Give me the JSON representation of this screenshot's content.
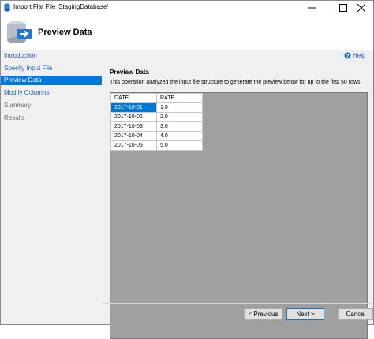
{
  "window": {
    "title": "Import Flat File 'StagingDatabase'",
    "icons": {
      "app": "database-icon",
      "minimize": "minimize-icon",
      "maximize": "maximize-icon",
      "close": "close-icon"
    }
  },
  "header": {
    "title": "Preview Data",
    "icon": "database-import-icon"
  },
  "nav": {
    "items": [
      {
        "label": "Introduction",
        "state": "link"
      },
      {
        "label": "Specify Input File",
        "state": "link"
      },
      {
        "label": "Preview Data",
        "state": "active"
      },
      {
        "label": "Modify Columns",
        "state": "link"
      },
      {
        "label": "Summary",
        "state": "disabled"
      },
      {
        "label": "Results",
        "state": "disabled"
      }
    ]
  },
  "main": {
    "help_label": "Help",
    "help_icon": "help-icon",
    "section_title": "Preview Data",
    "description": "This operation analyzed the input file structure to generate the preview below for up to the first 50 rows.",
    "grid": {
      "columns": [
        "DATE",
        "RATE"
      ],
      "rows": [
        [
          "2017-10-01",
          "1.0"
        ],
        [
          "2017-10-02",
          "2.0"
        ],
        [
          "2017-10-03",
          "3.0"
        ],
        [
          "2017-10-04",
          "4.0"
        ],
        [
          "2017-10-05",
          "5.0"
        ]
      ],
      "selected_cell": "2017-10-01"
    }
  },
  "footer": {
    "previous": "< Previous",
    "next": "Next >",
    "cancel": "Cancel"
  },
  "colors": {
    "accent": "#0078d7",
    "link": "#1f5fbf",
    "panel": "#f0f0f0",
    "grid_background": "#a0a0a0"
  }
}
